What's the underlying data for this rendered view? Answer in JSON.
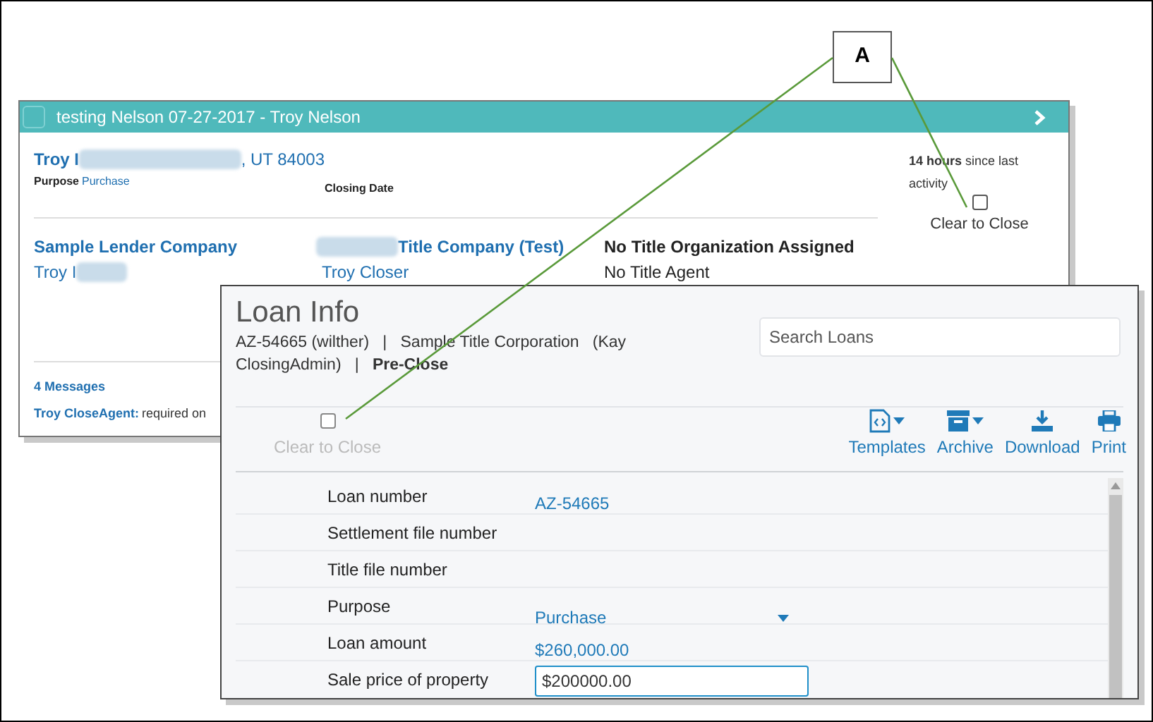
{
  "callout": {
    "label": "A"
  },
  "deal_card": {
    "title": "testing Nelson 07-27-2017 - Troy Nelson",
    "selected": false,
    "address": {
      "prefix": "Troy I",
      "suffix": ", UT 84003"
    },
    "purpose_label": "Purpose",
    "purpose_value": "Purchase",
    "closing_date_label": "Closing Date",
    "activity": "**14 hours** since last activity",
    "clear_to_close": {
      "label": "Clear to Close",
      "checked": false
    },
    "lender": {
      "name": "Sample Lender Company",
      "contact": "Troy I"
    },
    "title_company": {
      "name": "Title Company (Test)",
      "contact": "Troy Closer"
    },
    "title_org": {
      "name": "No Title Organization Assigned",
      "agent": "No Title Agent"
    },
    "messages": {
      "count": "4 Messages",
      "author": "Troy CloseAgent:",
      "text": "required on"
    }
  },
  "loan_info": {
    "title": "Loan Info",
    "subtitle": "AZ-54665 (wilther)   |   Sample Title Corporation   (Kay ClosingAdmin)   |   **Pre-Close**",
    "search": {
      "placeholder": "Search Loans"
    },
    "clear_to_close": {
      "label": "Clear to Close",
      "checked": false,
      "disabled": true
    },
    "toolbar": [
      {
        "kind": "templates",
        "label": "Templates",
        "menu": true
      },
      {
        "kind": "archive",
        "label": "Archive",
        "menu": true
      },
      {
        "kind": "download",
        "label": "Download",
        "menu": false
      },
      {
        "kind": "print",
        "label": "Print",
        "menu": false
      }
    ],
    "fields": [
      {
        "label": "Loan number",
        "kind": "link",
        "value": "AZ-54665"
      },
      {
        "label": "Settlement file number",
        "kind": "empty"
      },
      {
        "label": "Title file number",
        "kind": "empty"
      },
      {
        "label": "Purpose",
        "kind": "select",
        "value": "Purchase"
      },
      {
        "label": "Loan amount",
        "kind": "text",
        "value": "$260,000.00"
      },
      {
        "label": "Sale price of property",
        "kind": "input",
        "value": "$200000.00"
      }
    ]
  }
}
